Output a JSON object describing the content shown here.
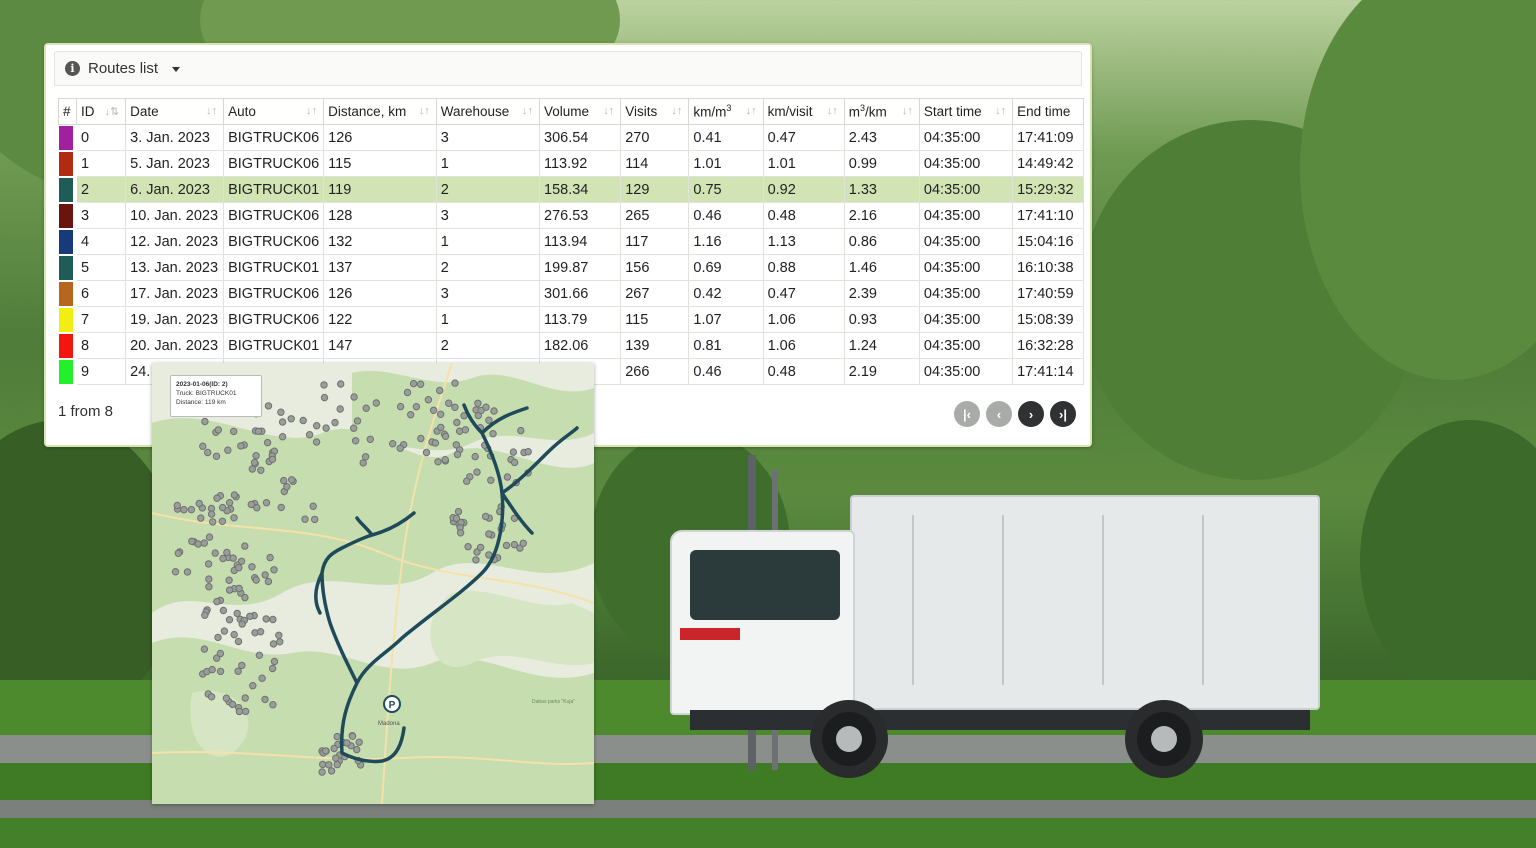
{
  "panel": {
    "title": "Routes list",
    "columns": [
      "#",
      "ID",
      "Date",
      "Auto",
      "Distance, km",
      "Warehouse",
      "Volume",
      "Visits",
      "km/m3",
      "km/visit",
      "m3/km",
      "Start time",
      "End time"
    ],
    "rows": [
      {
        "color": "#a020a0",
        "id": "0",
        "date": "3. Jan. 2023",
        "auto": "BIGTRUCK06",
        "distance": "126",
        "warehouse": "3",
        "volume": "306.54",
        "visits": "270",
        "km_m3": "0.41",
        "km_visit": "0.47",
        "m3_km": "2.43",
        "start": "04:35:00",
        "end": "17:41:09"
      },
      {
        "color": "#b22a12",
        "id": "1",
        "date": "5. Jan. 2023",
        "auto": "BIGTRUCK06",
        "distance": "115",
        "warehouse": "1",
        "volume": "113.92",
        "visits": "114",
        "km_m3": "1.01",
        "km_visit": "1.01",
        "m3_km": "0.99",
        "start": "04:35:00",
        "end": "14:49:42"
      },
      {
        "color": "#1f5c57",
        "id": "2",
        "date": "6. Jan. 2023",
        "auto": "BIGTRUCK01",
        "distance": "119",
        "warehouse": "2",
        "volume": "158.34",
        "visits": "129",
        "km_m3": "0.75",
        "km_visit": "0.92",
        "m3_km": "1.33",
        "start": "04:35:00",
        "end": "15:29:32",
        "selected": true
      },
      {
        "color": "#6a1410",
        "id": "3",
        "date": "10. Jan. 2023",
        "auto": "BIGTRUCK06",
        "distance": "128",
        "warehouse": "3",
        "volume": "276.53",
        "visits": "265",
        "km_m3": "0.46",
        "km_visit": "0.48",
        "m3_km": "2.16",
        "start": "04:35:00",
        "end": "17:41:10"
      },
      {
        "color": "#163a7a",
        "id": "4",
        "date": "12. Jan. 2023",
        "auto": "BIGTRUCK06",
        "distance": "132",
        "warehouse": "1",
        "volume": "113.94",
        "visits": "117",
        "km_m3": "1.16",
        "km_visit": "1.13",
        "m3_km": "0.86",
        "start": "04:35:00",
        "end": "15:04:16"
      },
      {
        "color": "#1f5c57",
        "id": "5",
        "date": "13. Jan. 2023",
        "auto": "BIGTRUCK01",
        "distance": "137",
        "warehouse": "2",
        "volume": "199.87",
        "visits": "156",
        "km_m3": "0.69",
        "km_visit": "0.88",
        "m3_km": "1.46",
        "start": "04:35:00",
        "end": "16:10:38"
      },
      {
        "color": "#b8651e",
        "id": "6",
        "date": "17. Jan. 2023",
        "auto": "BIGTRUCK06",
        "distance": "126",
        "warehouse": "3",
        "volume": "301.66",
        "visits": "267",
        "km_m3": "0.42",
        "km_visit": "0.47",
        "m3_km": "2.39",
        "start": "04:35:00",
        "end": "17:40:59"
      },
      {
        "color": "#f2ee12",
        "id": "7",
        "date": "19. Jan. 2023",
        "auto": "BIGTRUCK06",
        "distance": "122",
        "warehouse": "1",
        "volume": "113.79",
        "visits": "115",
        "km_m3": "1.07",
        "km_visit": "1.06",
        "m3_km": "0.93",
        "start": "04:35:00",
        "end": "15:08:39"
      },
      {
        "color": "#f2160e",
        "id": "8",
        "date": "20. Jan. 2023",
        "auto": "BIGTRUCK01",
        "distance": "147",
        "warehouse": "2",
        "volume": "182.06",
        "visits": "139",
        "km_m3": "0.81",
        "km_visit": "1.06",
        "m3_km": "1.24",
        "start": "04:35:00",
        "end": "16:32:28"
      },
      {
        "color": "#22f02a",
        "id": "9",
        "date": "24.",
        "auto": "",
        "distance": "",
        "warehouse": "",
        "volume": "",
        "visits": "266",
        "km_m3": "0.46",
        "km_visit": "0.48",
        "m3_km": "2.19",
        "start": "04:35:00",
        "end": "17:41:14"
      }
    ],
    "pager_text": "1 from 8",
    "pager_buttons": [
      {
        "icon": "first-page-icon",
        "glyph": "|‹",
        "state": "disabled"
      },
      {
        "icon": "prev-page-icon",
        "glyph": "‹",
        "state": "disabled"
      },
      {
        "icon": "next-page-icon",
        "glyph": "›",
        "state": "active"
      },
      {
        "icon": "last-page-icon",
        "glyph": "›|",
        "state": "active"
      }
    ]
  },
  "map": {
    "tooltip_title": "2023-01-06(ID: 2)",
    "tooltip_truck": "Truck: BIGTRUCK01",
    "tooltip_distance": "Distance: 119 km",
    "parking_label": "P",
    "town_label": "Madona",
    "park_label": "Dabas parks \"Kuja\""
  },
  "colors": {
    "selected_row": "#d3e4b4",
    "route_line": "#1e4a5a",
    "panel_border": "#d9e6b3"
  }
}
